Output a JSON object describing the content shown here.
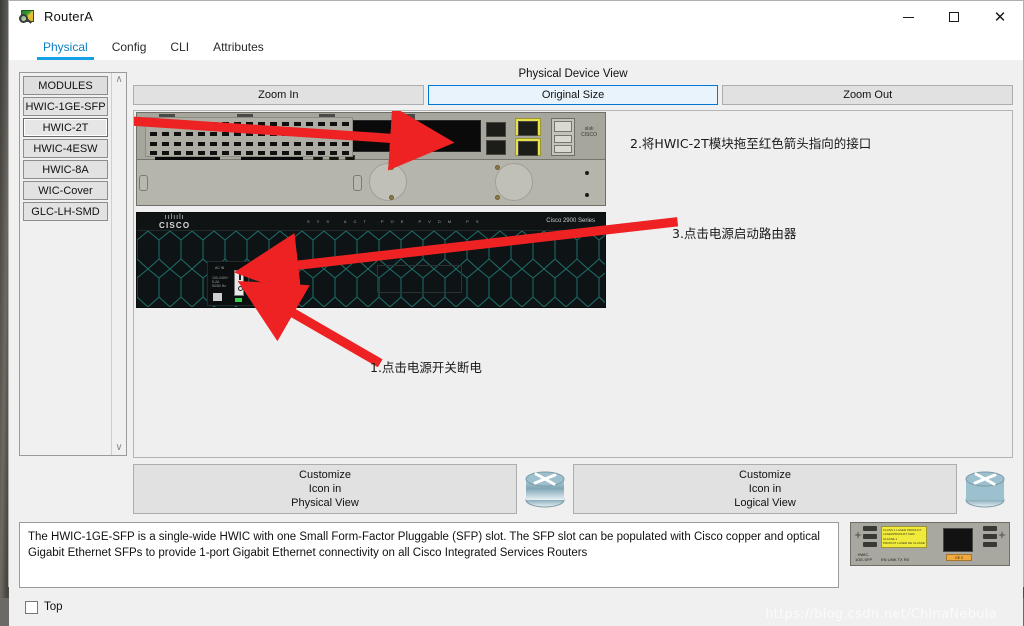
{
  "window": {
    "title": "RouterA",
    "app_icon": "packet-tracer-device-icon",
    "controls": {
      "minimize": "—",
      "maximize": "□",
      "close": "✕"
    }
  },
  "tabs": [
    {
      "label": "Physical",
      "active": true
    },
    {
      "label": "Config",
      "active": false
    },
    {
      "label": "CLI",
      "active": false
    },
    {
      "label": "Attributes",
      "active": false
    }
  ],
  "modules": {
    "header": "MODULES",
    "items": [
      {
        "label": "HWIC-1GE-SFP",
        "selected": false
      },
      {
        "label": "HWIC-2T",
        "selected": true
      },
      {
        "label": "HWIC-4ESW",
        "selected": false
      },
      {
        "label": "HWIC-8A",
        "selected": false
      },
      {
        "label": "WIC-Cover",
        "selected": false
      },
      {
        "label": "GLC-LH-SMD",
        "selected": false
      }
    ],
    "scroll_up": "∧",
    "scroll_down": "∨"
  },
  "device_view": {
    "title": "Physical Device View",
    "zoom_buttons": [
      {
        "label": "Zoom In",
        "active": false
      },
      {
        "label": "Original Size",
        "active": true
      },
      {
        "label": "Zoom Out",
        "active": false
      }
    ],
    "device_brand": "CISCO",
    "device_series": "Cisco 2900 Series",
    "front_led_labels": "SYS ACT POE PVDM PS",
    "psu": {
      "ac_in": "AC IN",
      "warning": "100-240V~\n5-2A\n50/60 Hz",
      "switch_on": "I",
      "switch_off": "O"
    }
  },
  "annotations": [
    {
      "id": "anno1",
      "text": "1.点击电源开关断电"
    },
    {
      "id": "anno2",
      "text": "2.将HWIC-2T模块拖至红色箭头指向的接口"
    },
    {
      "id": "anno3",
      "text": "3.点击电源启动路由器"
    }
  ],
  "customize": {
    "physical": {
      "line1": "Customize",
      "line2": "Icon in",
      "line3": "Physical View"
    },
    "logical": {
      "line1": "Customize",
      "line2": "Icon in",
      "line3": "Logical View"
    }
  },
  "description": "The HWIC-1GE-SFP is a single-wide HWIC with one Small Form-Factor Pluggable (SFP) slot. The SFP slot can be populated with Cisco copper and optical Gigabit Ethernet SFPs to provide 1-port Gigabit Ethernet connectivity on all Cisco Integrated Services Routers",
  "module_preview": {
    "name": "HWIC-1GE-SFP",
    "laser_label": "CLASS 1 LASER PRODUCT\nLASERPRODUKT DER KLASSE 1\nPRODUIT LASER DE CLASSE 1\nPRODUCTO LASER CLASE 1",
    "port_label": "GE 0",
    "led_labels": "EN      LINK  TX   RX"
  },
  "bottom": {
    "top_checkbox_label": "Top",
    "top_checked": false
  },
  "watermark": "https://blog.csdn.net/ChinaNebula",
  "colors": {
    "accent": "#14a0e6",
    "tab_active_text": "#0a7fc2",
    "arrow_red": "#ee2222",
    "button_face": "#e1e1e1",
    "window_bg": "#f0f0f0",
    "selected_button_border": "#0078d7"
  }
}
